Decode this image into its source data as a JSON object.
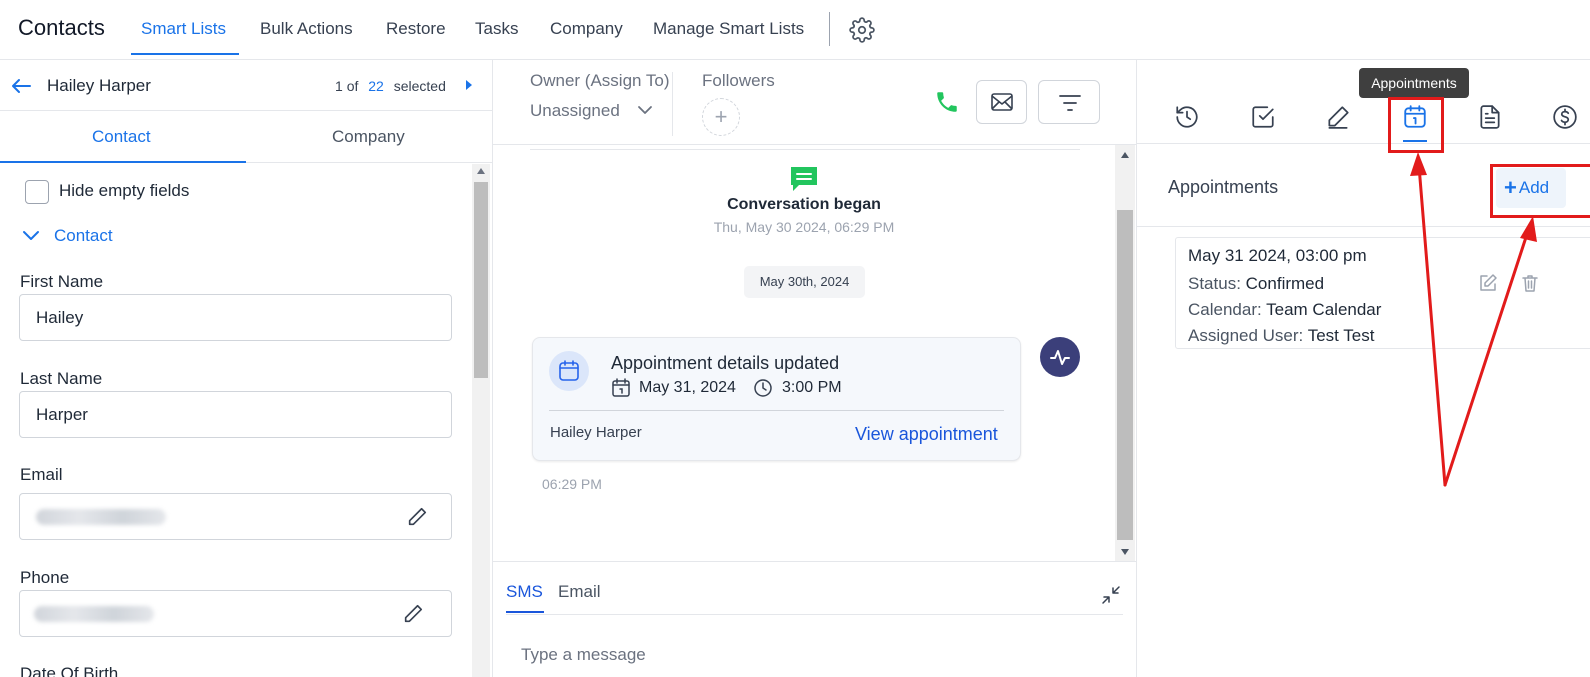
{
  "topnav": {
    "title": "Contacts",
    "items": [
      {
        "label": "Smart Lists"
      },
      {
        "label": "Bulk Actions"
      },
      {
        "label": "Restore"
      },
      {
        "label": "Tasks"
      },
      {
        "label": "Company"
      },
      {
        "label": "Manage Smart Lists"
      }
    ],
    "settings_icon": "gear-icon"
  },
  "left": {
    "contact_name": "Hailey Harper",
    "pager": {
      "current": "1",
      "of_label": "of",
      "total": "22",
      "selected_label": "selected"
    },
    "tabs": [
      {
        "label": "Contact"
      },
      {
        "label": "Company"
      }
    ],
    "hide_empty_label": "Hide empty fields",
    "section_title": "Contact",
    "fields": {
      "first_name": {
        "label": "First Name",
        "value": "Hailey"
      },
      "last_name": {
        "label": "Last Name",
        "value": "Harper"
      },
      "email": {
        "label": "Email"
      },
      "phone": {
        "label": "Phone"
      }
    },
    "cut_label": "Date Of Birth"
  },
  "middle": {
    "owner_label": "Owner (Assign To)",
    "owner_value": "Unassigned",
    "followers_label": "Followers",
    "conversation": {
      "began_title": "Conversation began",
      "began_date": "Thu, May 30 2024, 06:29 PM",
      "date_pill": "May 30th, 2024",
      "card": {
        "title": "Appointment details updated",
        "date": "May 31, 2024",
        "time": "3:00 PM",
        "person": "Hailey Harper",
        "link": "View appointment"
      },
      "time": "06:29 PM"
    },
    "composer": {
      "tabs": [
        {
          "label": "SMS"
        },
        {
          "label": "Email"
        }
      ],
      "placeholder": "Type a message"
    }
  },
  "right": {
    "tooltip": "Appointments",
    "title": "Appointments",
    "add_label": "Add",
    "appointment": {
      "when": "May 31 2024, 03:00 pm",
      "status_label": "Status:",
      "status_value": "Confirmed",
      "calendar_label": "Calendar:",
      "calendar_value": "Team Calendar",
      "assigned_label": "Assigned User:",
      "assigned_value": "Test Test"
    }
  },
  "colors": {
    "accent": "#1a73e8",
    "annotation_red": "#e21b1b",
    "phone_green": "#22c55e"
  }
}
